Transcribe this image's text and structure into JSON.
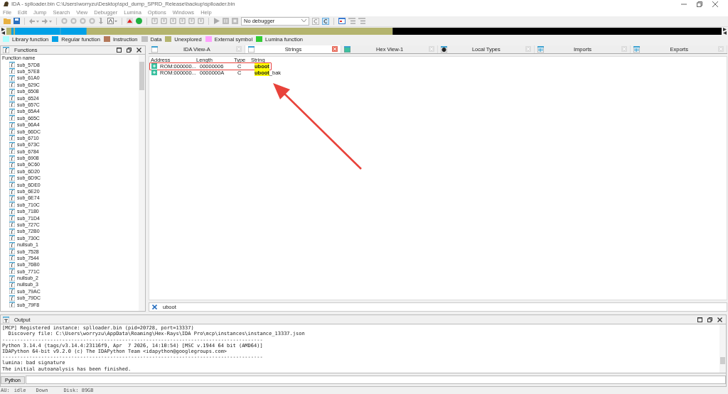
{
  "window": {
    "title": "IDA - splloader.bin C:\\Users\\worryzu\\Desktop\\spd_dump_SPRD_Release\\backup\\splloader.bin"
  },
  "menu": [
    "File",
    "Edit",
    "Jump",
    "Search",
    "View",
    "Debugger",
    "Lumina",
    "Options",
    "Windows",
    "Help"
  ],
  "toolbar": {
    "debugger_select": "No debugger"
  },
  "legend": [
    {
      "label": "Library function",
      "color": "#aaffff"
    },
    {
      "label": "Regular function",
      "color": "#00a0e6"
    },
    {
      "label": "Instruction",
      "color": "#b4785a"
    },
    {
      "label": "Data",
      "color": "#c0c0c0"
    },
    {
      "label": "Unexplored",
      "color": "#b4b46e"
    },
    {
      "label": "External symbol",
      "color": "#ffa0ff"
    },
    {
      "label": "Lumina function",
      "color": "#32cd32"
    }
  ],
  "functions_pane": {
    "title": "Functions",
    "column": "Function name",
    "items": [
      "sub_57D8",
      "sub_57E8",
      "sub_61A0",
      "sub_629C",
      "sub_6508",
      "sub_6524",
      "sub_657C",
      "sub_65A4",
      "sub_665C",
      "sub_66A4",
      "sub_66DC",
      "sub_6710",
      "sub_673C",
      "sub_6784",
      "sub_6908",
      "sub_6C60",
      "sub_6D20",
      "sub_6D9C",
      "sub_6DE0",
      "sub_6E20",
      "sub_6E74",
      "sub_710C",
      "sub_7180",
      "sub_71D4",
      "sub_727C",
      "sub_72B0",
      "sub_730C",
      "nullsub_1",
      "sub_7528",
      "sub_7544",
      "sub_76B0",
      "sub_771C",
      "nullsub_2",
      "nullsub_3",
      "sub_79AC",
      "sub_79DC",
      "sub_79F8"
    ]
  },
  "tabs": [
    {
      "label": "IDA View-A",
      "selected": false
    },
    {
      "label": "Strings",
      "selected": true
    },
    {
      "label": "Hex View-1",
      "selected": false
    },
    {
      "label": "Local Types",
      "selected": false
    },
    {
      "label": "Imports",
      "selected": false
    },
    {
      "label": "Exports",
      "selected": false
    }
  ],
  "strings_table": {
    "columns": [
      "Address",
      "Length",
      "Type",
      "String"
    ],
    "rows": [
      {
        "address": "ROM:000000...",
        "length": "00000006",
        "type": "C",
        "match": "uboot",
        "rest": "",
        "annotated": true
      },
      {
        "address": "ROM:000000...",
        "length": "0000000A",
        "type": "C",
        "match": "uboot",
        "rest": "_bak",
        "annotated": false
      }
    ]
  },
  "filter": {
    "value": "uboot"
  },
  "output": {
    "title": "Output",
    "lines": [
      "[MCP] Registered instance: splloader.bin (pid=20728, port=13337)",
      "  Discovery file: C:\\Users\\worryzu\\AppData\\Roaming\\Hex-Rays\\IDA Pro\\mcp\\instances\\instance_13337.json",
      "---------------------------------------------------------------------------------------",
      "Python 3.14.4 (tags/v3.14.4:23116f9, Apr  7 2026, 14:10:54) [MSC v.1944 64 bit (AMD64)]",
      "IDAPython 64-bit v9.2.0 (c) The IDAPython Team <idapython@googlegroups.com>",
      "---------------------------------------------------------------------------------------",
      "lumina: bad signature",
      "The initial autoanalysis has been finished."
    ],
    "language": "Python"
  },
  "status_bar": [
    "AU:",
    "idle",
    "Down",
    "Disk: 89GB"
  ]
}
